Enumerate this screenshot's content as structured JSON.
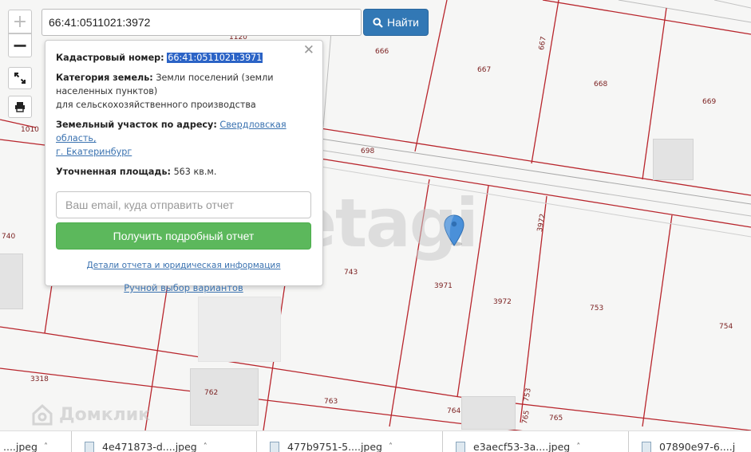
{
  "search": {
    "value": "66:41:0511021:3972",
    "button_label": "Найти"
  },
  "controls": {
    "zoom_in": "+",
    "zoom_out": "−"
  },
  "popup": {
    "close": "✕",
    "cadastral_label": "Кадастровый номер:",
    "cadastral_value": "66:41:0511021:3971",
    "category_label": "Категория земель:",
    "category_value_1": "Земли поселений (земли",
    "category_value_2": "населенных пунктов)",
    "category_value_3": "для сельскохозяйственного производства",
    "address_label": "Земельный участок по адресу:",
    "address_link_1": "Свердловская область,",
    "address_link_2": "г. Екатеринбург",
    "area_label": "Уточненная площадь:",
    "area_value": "563 кв.м.",
    "email_placeholder": "Ваш email, куда отправить отчет",
    "report_button": "Получить подробный отчет",
    "details_link": "Детали отчета и юридическая информация",
    "manual_link": "Ручной выбор вариантов"
  },
  "plots": [
    "1010",
    "666",
    "667",
    "667",
    "668",
    "669",
    "698",
    "740",
    "743",
    "3971",
    "3972",
    "3972",
    "753",
    "754",
    "3318",
    "762",
    "763",
    "764",
    "765",
    "765",
    "753",
    "1120"
  ],
  "watermarks": {
    "etagi": "etagi",
    "domclick": "Домклик"
  },
  "downloads": [
    {
      "name": "....jpeg"
    },
    {
      "name": "4e471873-d....jpeg"
    },
    {
      "name": "477b9751-5....jpeg"
    },
    {
      "name": "e3aecf53-3a....jpeg"
    },
    {
      "name": "07890e97-6....j"
    }
  ],
  "colors": {
    "plot_border": "#b8252c",
    "road_line": "#9a9a9a",
    "search_button": "#3278b5",
    "report_button": "#5cb85c",
    "marker": "#4a90d9"
  }
}
